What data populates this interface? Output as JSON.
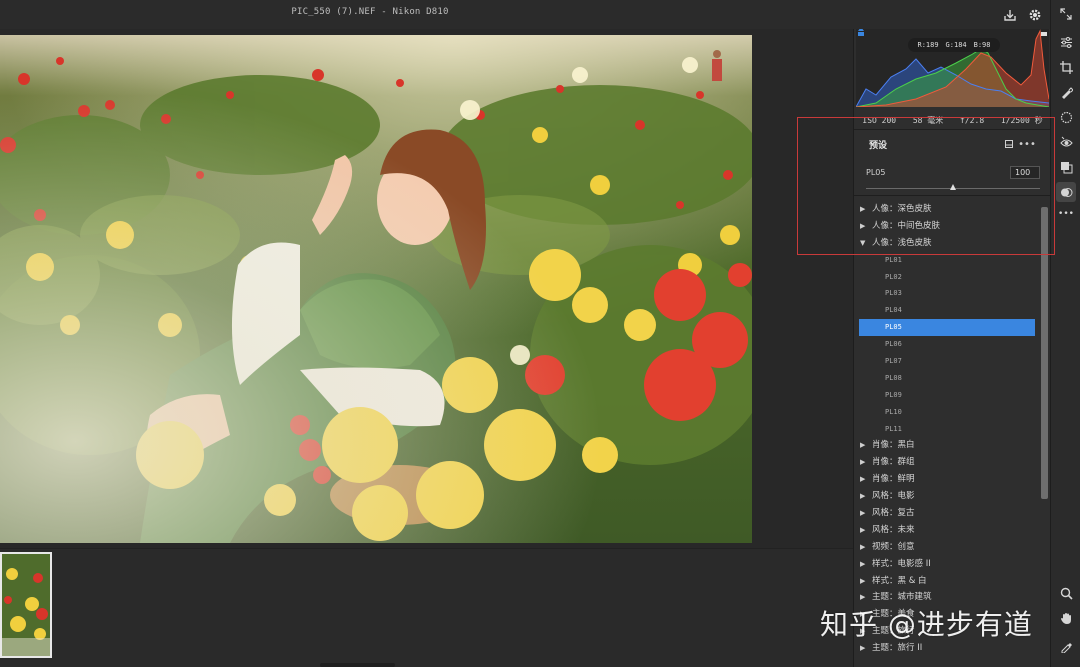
{
  "window": {
    "title": "PIC_550 (7).NEF -  Nikon D810"
  },
  "histogram": {
    "rgb_readout": {
      "r": "R:189",
      "g": "G:184",
      "b": "B:98"
    }
  },
  "exif": {
    "iso": "ISO 200",
    "focal_length": "58 毫米",
    "aperture": "f/2.8",
    "shutter": "1/2500 秒"
  },
  "presets": {
    "title": "预设",
    "amount_label": "PL05",
    "amount_value": "100",
    "slider_value_fraction": 0.5,
    "groups": [
      {
        "label": "人像：深色皮肤",
        "expanded": false
      },
      {
        "label": "人像：中间色皮肤",
        "expanded": false
      },
      {
        "label": "人像：浅色皮肤",
        "expanded": true,
        "items": [
          "PL01",
          "PL02",
          "PL03",
          "PL04",
          "PL05",
          "PL06",
          "PL07",
          "PL08",
          "PL09",
          "PL10",
          "PL11"
        ],
        "selected": "PL05"
      },
      {
        "label": "肖像：黑白",
        "expanded": false
      },
      {
        "label": "肖像：群组",
        "expanded": false
      },
      {
        "label": "肖像：鲜明",
        "expanded": false
      },
      {
        "label": "风格：电影",
        "expanded": false
      },
      {
        "label": "风格：复古",
        "expanded": false
      },
      {
        "label": "风格：未来",
        "expanded": false
      },
      {
        "label": "视频：创意",
        "expanded": false
      },
      {
        "label": "样式：电影感 II",
        "expanded": false
      },
      {
        "label": "样式：黑 & 白",
        "expanded": false
      },
      {
        "label": "主题：城市建筑",
        "expanded": false
      },
      {
        "label": "主题：美食",
        "expanded": false
      },
      {
        "label": "主题：旅行",
        "expanded": false
      },
      {
        "label": "主题：旅行 II",
        "expanded": false
      }
    ]
  },
  "watermark": "知乎 @进步有道",
  "colors": {
    "accent": "#3a86e0",
    "annotation": "#c93a3a",
    "panel_bg": "#2e2e2e"
  },
  "icons": {
    "titlebar": [
      "export-icon",
      "gear-icon",
      "expand-icon"
    ],
    "toolrail": [
      "sliders-icon",
      "crop-icon",
      "healing-brush-icon",
      "mask-icon",
      "red-eye-icon",
      "layers-icon",
      "presets-icon",
      "more-icon",
      "zoom-icon",
      "hand-icon",
      "eyedropper-icon"
    ]
  }
}
